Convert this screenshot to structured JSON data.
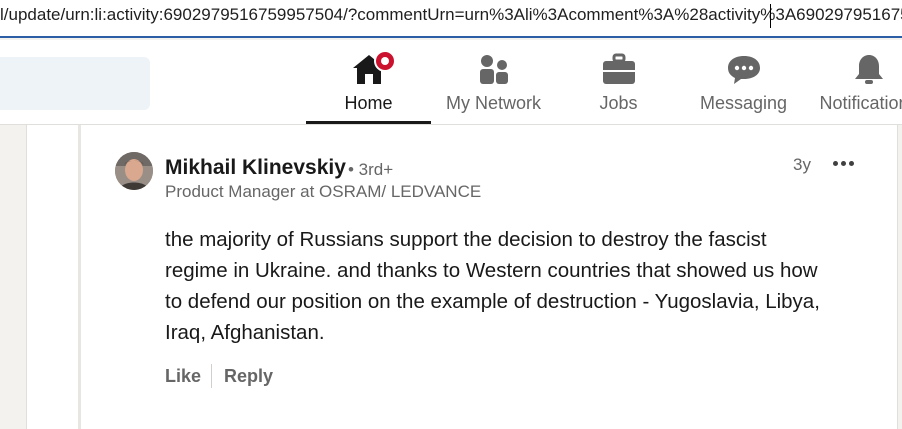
{
  "browser": {
    "url": "l/update/urn:li:activity:6902979516759957504/?commentUrn=urn%3Ali%3Acomment%3A%28activity%3A690297951675"
  },
  "nav": {
    "items": [
      {
        "label": "Home",
        "icon": "home-icon",
        "active": true,
        "notification": true
      },
      {
        "label": "My Network",
        "icon": "people-icon"
      },
      {
        "label": "Jobs",
        "icon": "briefcase-icon"
      },
      {
        "label": "Messaging",
        "icon": "chat-bubble-icon"
      },
      {
        "label": "Notifications",
        "icon": "bell-icon"
      }
    ]
  },
  "comment": {
    "author": "Mikhail Klinevskiy",
    "degree": "• 3rd+",
    "headline": "Product Manager at OSRAM/ LEDVANCE",
    "time": "3y",
    "lines": [
      "the majority of Russians support the decision to destroy the fascist",
      "regime in Ukraine. and thanks to Western countries that showed us how",
      "to defend our position on the example of destruction - Yugoslavia, Libya,",
      "Iraq, Afghanistan."
    ],
    "actions": {
      "like": "Like",
      "reply": "Reply"
    }
  }
}
